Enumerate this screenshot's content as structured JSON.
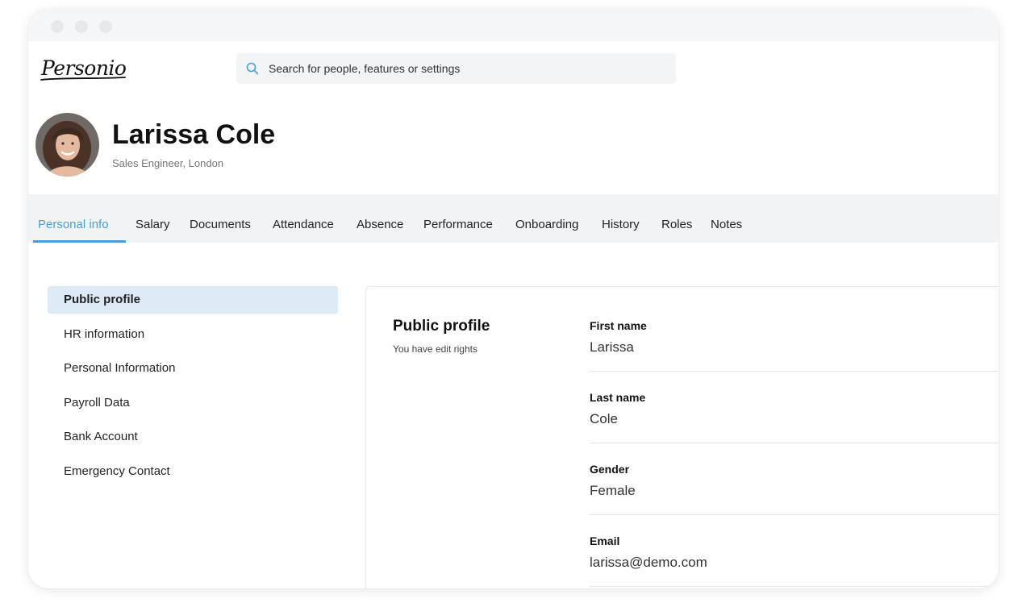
{
  "app": {
    "logo_text": "Personio"
  },
  "search": {
    "placeholder": "Search for people, features or settings"
  },
  "profile": {
    "name": "Larissa Cole",
    "subtitle": "Sales Engineer, London"
  },
  "tabs": [
    {
      "label": "Personal info",
      "active": true
    },
    {
      "label": "Salary"
    },
    {
      "label": "Documents"
    },
    {
      "label": "Attendance"
    },
    {
      "label": "Absence"
    },
    {
      "label": "Performance"
    },
    {
      "label": "Onboarding"
    },
    {
      "label": "History"
    },
    {
      "label": "Roles"
    },
    {
      "label": "Notes"
    }
  ],
  "sidenav": [
    {
      "label": "Public profile",
      "active": true
    },
    {
      "label": "HR information"
    },
    {
      "label": "Personal Information"
    },
    {
      "label": "Payroll Data"
    },
    {
      "label": "Bank Account"
    },
    {
      "label": "Emergency Contact"
    }
  ],
  "section": {
    "title": "Public profile",
    "subtitle": "You have edit rights",
    "fields": [
      {
        "label": "First name",
        "value": "Larissa"
      },
      {
        "label": "Last name",
        "value": "Cole"
      },
      {
        "label": "Gender",
        "value": "Female"
      },
      {
        "label": "Email",
        "value": "larissa@demo.com"
      }
    ]
  },
  "colors": {
    "accent": "#4a9fd8",
    "active_nav_bg": "#dbeaf5",
    "tabbar_bg": "#f2f3f5"
  }
}
